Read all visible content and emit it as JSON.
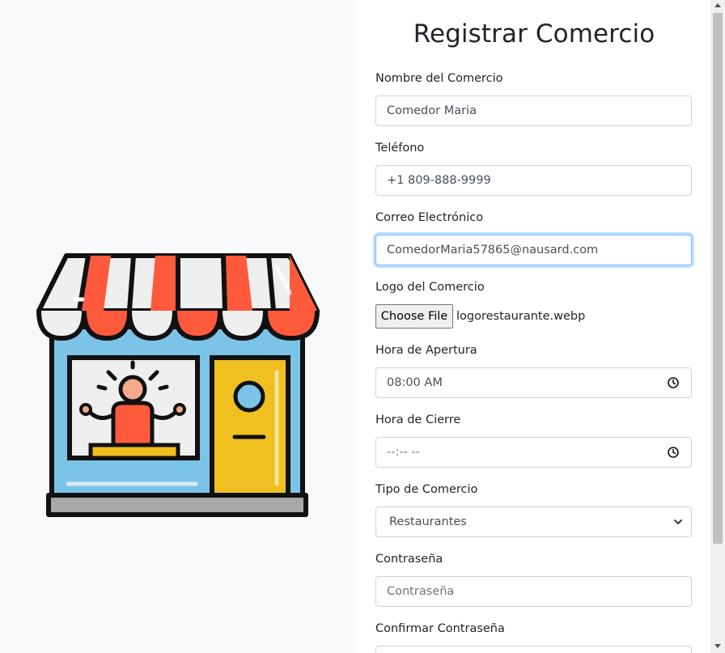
{
  "form": {
    "title": "Registrar Comercio",
    "nombre": {
      "label": "Nombre del Comercio",
      "value": "Comedor Maria"
    },
    "telefono": {
      "label": "Teléfono",
      "value": "+1 809-888-9999"
    },
    "correo": {
      "label": "Correo Electrónico",
      "value": "ComedorMaria57865@nausard.com"
    },
    "logo": {
      "label": "Logo del Comercio",
      "button": "Choose File",
      "filename": "logorestaurante.webp"
    },
    "apertura": {
      "label": "Hora de Apertura",
      "value": "08:00 AM"
    },
    "cierre": {
      "label": "Hora de Cierre",
      "value": "--:-- --"
    },
    "tipo": {
      "label": "Tipo de Comercio",
      "selected": "Restaurantes"
    },
    "contrasena": {
      "label": "Contraseña",
      "placeholder": "Contraseña"
    },
    "confirmar": {
      "label": "Confirmar Contraseña"
    }
  },
  "illustration": {
    "icon": "storefront-icon"
  },
  "colors": {
    "awning_red": "#ff5a3c",
    "awning_white": "#efefef",
    "wall_blue": "#7cc3e8",
    "door_yellow": "#f0c020",
    "base_gray": "#a8a8a8",
    "focus_border": "#80bdff"
  }
}
